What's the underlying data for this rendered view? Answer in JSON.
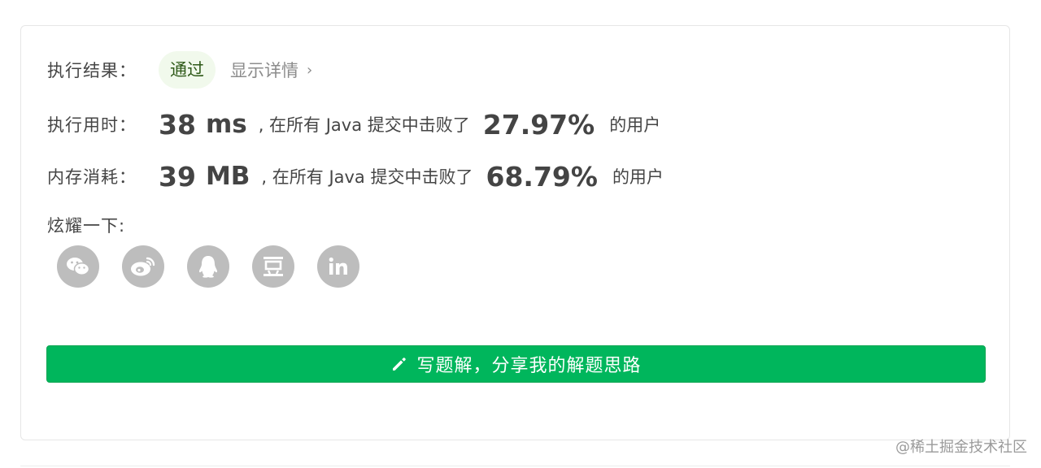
{
  "result": {
    "label": "执行结果：",
    "status": "通过",
    "detail_link": "显示详情",
    "detail_chevron": "›"
  },
  "runtime": {
    "label": "执行用时：",
    "value": "38",
    "unit": "ms",
    "middle_text": ", 在所有 Java 提交中击败了",
    "percent": "27.97%",
    "tail_text": "的用户"
  },
  "memory": {
    "label": "内存消耗：",
    "value": "39",
    "unit": "MB",
    "middle_text": ", 在所有 Java 提交中击败了",
    "percent": "68.79%",
    "tail_text": "的用户"
  },
  "share": {
    "label": "炫耀一下:",
    "icons": [
      "wechat-icon",
      "weibo-icon",
      "qq-icon",
      "douban-icon",
      "linkedin-icon"
    ]
  },
  "write_button": {
    "label": "写题解，分享我的解题思路",
    "icon": "pencil-icon"
  },
  "watermark": "@稀土掘金技术社区",
  "colors": {
    "primary_green": "#00b65c",
    "badge_bg": "#f1f9ec",
    "icon_gray": "#bdbdbd"
  }
}
